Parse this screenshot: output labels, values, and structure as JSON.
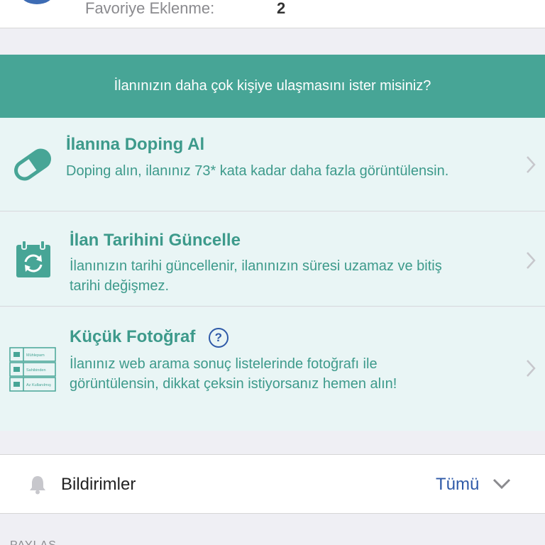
{
  "stats": {
    "favorites_label": "Favoriye Eklenme:",
    "favorites_count": "2"
  },
  "promo": {
    "header": "İlanınızın daha çok kişiye ulaşmasını ister misiniz?",
    "items": [
      {
        "title": "İlanına Doping Al",
        "desc_lines": [
          "Doping alın, ilanınız 73* kata kadar daha fazla görüntülensin."
        ],
        "icon": "pill-icon"
      },
      {
        "title": "İlan Tarihini Güncelle",
        "desc_lines": [
          "İlanınızın tarihi güncellenir, ilanınızın süresi uzamaz ve bitiş",
          "tarihi değişmez."
        ],
        "icon": "calendar-refresh-icon"
      },
      {
        "title": "Küçük Fotoğraf",
        "help_symbol": "?",
        "desc_lines": [
          "İlanınız web arama sonuç listelerinde fotoğrafı ile",
          "görüntülensin, dikkat çeksin istiyorsanız hemen alın!"
        ],
        "icon": "thumbnail-list-icon",
        "thumb_rows": [
          "Mühlepam",
          "Sahibinden",
          "Az Kullanılmış"
        ]
      }
    ]
  },
  "notifications": {
    "label": "Bildirimler",
    "value": "Tümü",
    "icon": "bell-icon"
  },
  "share": {
    "label": "PAYLAŞ"
  },
  "colors": {
    "accent": "#47a596",
    "text_teal": "#3d9a8b",
    "link_blue": "#2f5aa8",
    "row_bg": "#e9f5f5"
  }
}
